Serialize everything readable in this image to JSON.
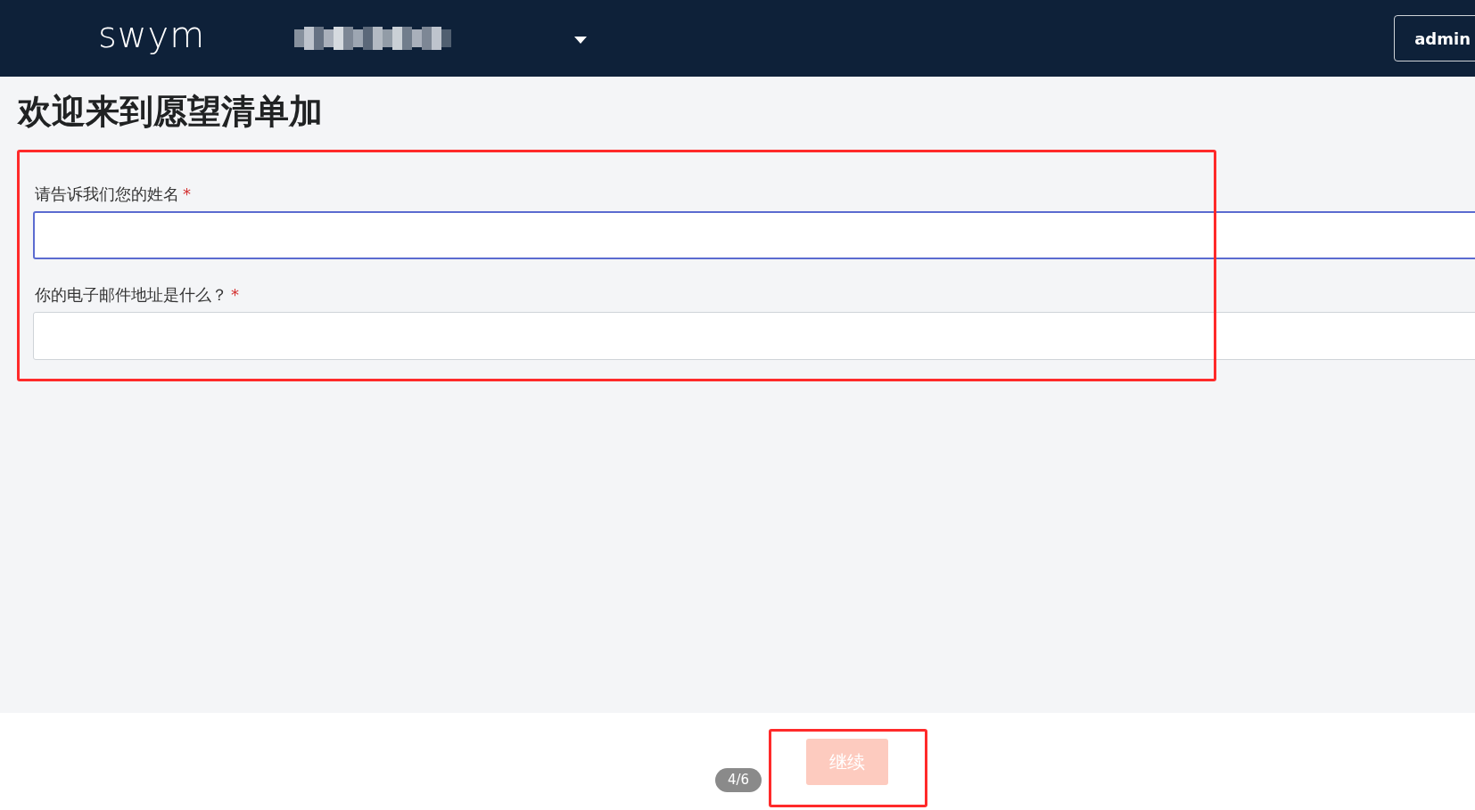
{
  "header": {
    "logo": "swym",
    "user_button": "admin"
  },
  "title": "欢迎来到愿望清单加",
  "fields": [
    {
      "label": "请告诉我们您的姓名",
      "required_mark": "*",
      "focused": true
    },
    {
      "label": "你的电子邮件地址是什么？",
      "required_mark": "*",
      "focused": false
    }
  ],
  "footer": {
    "progress": "4/6",
    "continue_button": {
      "label": "继续",
      "disabled": true
    }
  }
}
